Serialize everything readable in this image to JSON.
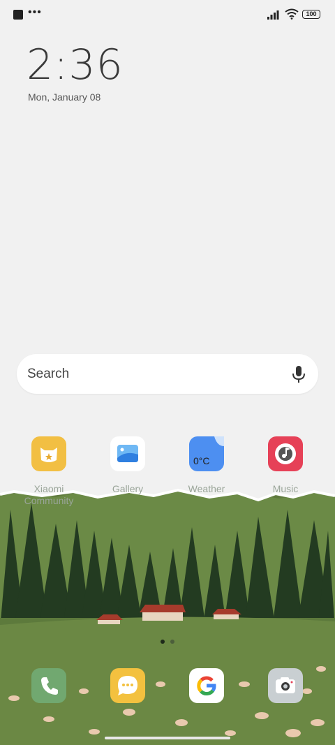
{
  "status_bar": {
    "battery": "100"
  },
  "lock": {
    "time": "2:36",
    "date": "Mon, January 08"
  },
  "search": {
    "placeholder": "Search"
  },
  "apps": [
    {
      "label": "Xiaomi Community",
      "icon": "xiaomi-community-icon",
      "color": "#f2bf43"
    },
    {
      "label": "Gallery",
      "icon": "gallery-icon",
      "color": "#ffffff"
    },
    {
      "label": "Weather",
      "icon": "weather-icon",
      "color": "#4d8ff1",
      "temp": "0°C"
    },
    {
      "label": "Music",
      "icon": "music-icon",
      "color": "#e64157"
    }
  ],
  "dock": [
    {
      "icon": "phone-icon",
      "color": "#71a870"
    },
    {
      "icon": "messages-icon",
      "color": "#f3c13f"
    },
    {
      "icon": "google-icon",
      "color": "#ffffff"
    },
    {
      "icon": "camera-icon",
      "color": "#c9cfd2"
    }
  ],
  "page_indicator": {
    "count": 2,
    "active": 0
  }
}
